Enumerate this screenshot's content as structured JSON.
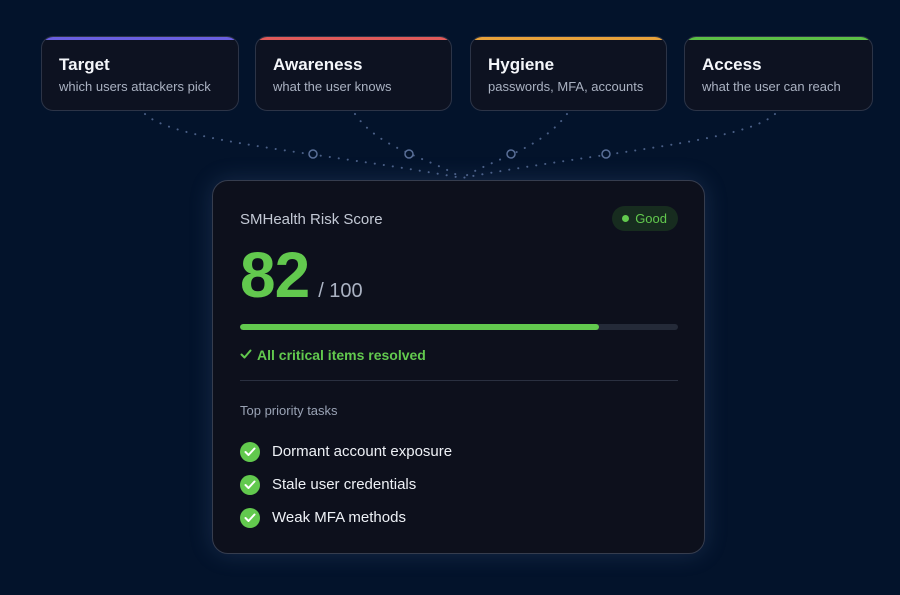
{
  "pillars": [
    {
      "title": "Target",
      "subtitle": "which users attackers pick",
      "accent": "#6a5fe0"
    },
    {
      "title": "Awareness",
      "subtitle": "what the user knows",
      "accent": "#e05a5a"
    },
    {
      "title": "Hygiene",
      "subtitle": "passwords, MFA, accounts",
      "accent": "#e8a23a"
    },
    {
      "title": "Access",
      "subtitle": "what the user can reach",
      "accent": "#5bbf45"
    }
  ],
  "score_card": {
    "title": "SMHealth Risk Score",
    "badge": "Good",
    "score": "82",
    "max": "/ 100",
    "progress_fraction": 0.82,
    "resolved_text": "All critical items resolved",
    "section_label": "Top priority tasks",
    "tasks": [
      "Dormant account exposure",
      "Stale user credentials",
      "Weak MFA methods"
    ]
  },
  "colors": {
    "background": "#03132b",
    "good": "#62c94e",
    "connector": "#4a5f86"
  },
  "icons": {
    "resolved": "check-icon",
    "task": "check-circle-icon",
    "badge": "status-dot-icon"
  }
}
